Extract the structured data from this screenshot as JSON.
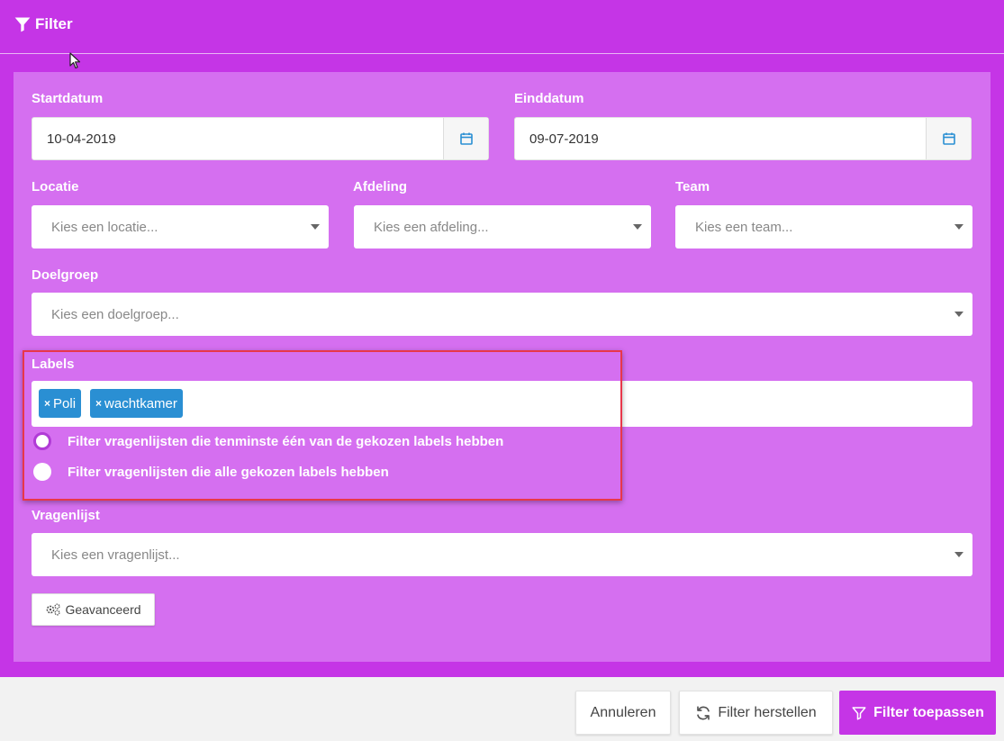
{
  "header": {
    "title": "Filter"
  },
  "form": {
    "startdatum": {
      "label": "Startdatum",
      "value": "10-04-2019"
    },
    "einddatum": {
      "label": "Einddatum",
      "value": "09-07-2019"
    },
    "locatie": {
      "label": "Locatie",
      "placeholder": "Kies een locatie..."
    },
    "afdeling": {
      "label": "Afdeling",
      "placeholder": "Kies een afdeling..."
    },
    "team": {
      "label": "Team",
      "placeholder": "Kies een team..."
    },
    "doelgroep": {
      "label": "Doelgroep",
      "placeholder": "Kies een doelgroep..."
    },
    "labels": {
      "label": "Labels",
      "tags": [
        "Poli",
        "wachtkamer"
      ],
      "remove_glyph": "×",
      "options": [
        {
          "text": "Filter vragenlijsten die tenminste één van de gekozen labels hebben",
          "selected": true
        },
        {
          "text": "Filter vragenlijsten die alle gekozen labels hebben",
          "selected": false
        }
      ]
    },
    "vragenlijst": {
      "label": "Vragenlijst",
      "placeholder": "Kies een vragenlijst..."
    },
    "advanced_button": "Geavanceerd"
  },
  "footer": {
    "cancel": "Annuleren",
    "reset": "Filter herstellen",
    "apply": "Filter toepassen"
  },
  "colors": {
    "header_bg": "#c535e6",
    "panel_bg": "#d56ff0",
    "tag_bg": "#2a8fd3",
    "highlight": "#e8374a"
  }
}
